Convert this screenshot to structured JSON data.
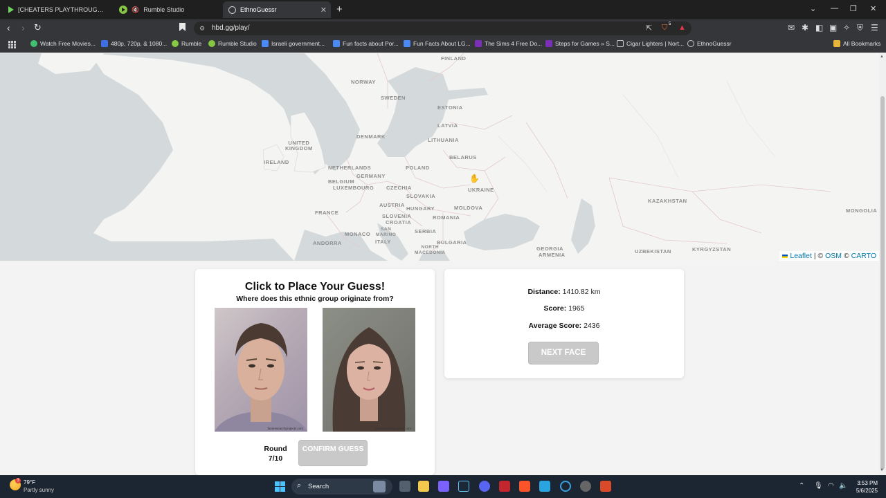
{
  "browser": {
    "tabs": [
      {
        "title": "[CHEATERS PLAYTHROUGH] OBLIVI",
        "icon": "rumble-play-icon"
      },
      {
        "title": "Rumble Studio",
        "icon": "rumble-studio-icon"
      },
      {
        "title": "EthnoGuessr",
        "icon": "globe-icon",
        "active": true
      }
    ],
    "url": "hbd.gg/play/",
    "bookmarks": [
      "Watch Free Movies...",
      "480p, 720p, & 1080...",
      "Rumble",
      "Rumble Studio",
      "Israeli government...",
      "Fun facts about Por...",
      "Fun Facts About LG...",
      "The Sims 4 Free Do...",
      "Steps for Games » S...",
      "Cigar Lighters | Nort...",
      "EthnoGuessr"
    ],
    "all_bookmarks": "All Bookmarks",
    "shield_badge": "5"
  },
  "map": {
    "labels": [
      "FINLAND",
      "NORWAY",
      "SWEDEN",
      "ESTONIA",
      "LATVIA",
      "DENMARK",
      "LITHUANIA",
      "UNITED\nKINGDOM",
      "IRELAND",
      "NETHERLANDS",
      "BELARUS",
      "POLAND",
      "BELGIUM",
      "GERMANY",
      "LUXEMBOURG",
      "CZECHIA",
      "UKRAINE",
      "SLOVAKIA",
      "AUSTRIA",
      "HUNGARY",
      "MOLDOVA",
      "FRANCE",
      "SLOVENIA",
      "CROATIA",
      "ROMANIA",
      "SAN\nMARINO",
      "MONACO",
      "SERBIA",
      "ANDORRA",
      "ITALY",
      "BULGARIA",
      "NORTH\nMACEDONIA",
      "KAZAKHSTAN",
      "MONGOLIA",
      "GEORGIA",
      "ARMENIA",
      "UZBEKISTAN",
      "KYRGYZSTAN"
    ],
    "attribution": {
      "leaflet": "Leaflet",
      "sep1": " | © ",
      "osm": "OSM",
      "sep2": " © ",
      "carto": "CARTO"
    },
    "colors": {
      "land": "#f4f4f2",
      "water": "#d4dadc",
      "border": "#e3c9cf"
    }
  },
  "game": {
    "title": "Click to Place Your Guess!",
    "subtitle": "Where does this ethnic group originate from?",
    "faces": [
      {
        "name": "male-face",
        "watermark": "faceresearchprojects.com"
      },
      {
        "name": "female-face",
        "watermark": "faceresearchprojects.com"
      }
    ],
    "round_label": "Round",
    "round_value": "7/10",
    "confirm_label": "CONFIRM GUESS"
  },
  "results": {
    "distance_label": "Distance:",
    "distance_value": "1410.82 km",
    "score_label": "Score:",
    "score_value": "1965",
    "avg_label": "Average Score:",
    "avg_value": "2436",
    "next_label": "NEXT FACE"
  },
  "taskbar": {
    "weather_temp": "79°F",
    "weather_desc": "Partly sunny",
    "weather_badge": "3",
    "search_label": "Search",
    "time": "3:53 PM",
    "date": "5/6/2025"
  }
}
